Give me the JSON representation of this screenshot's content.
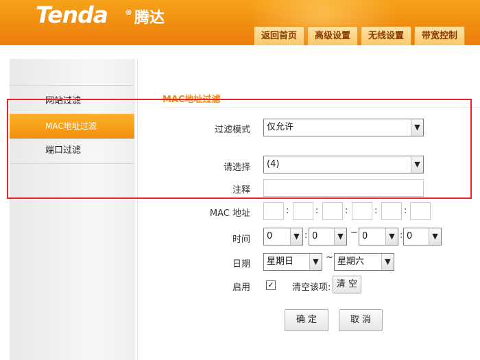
{
  "brand": {
    "logo": "Tenda",
    "registered": "®",
    "chinese": "腾达"
  },
  "nav": {
    "tabs": [
      "返回首页",
      "高级设置",
      "无线设置",
      "带宽控制"
    ]
  },
  "sidebar": {
    "items": [
      "网站过滤",
      "MAC地址过滤",
      "端口过滤"
    ]
  },
  "section": {
    "title": "MAC地址过滤"
  },
  "form": {
    "filter_mode": {
      "label": "过滤模式",
      "value": "仅允许"
    },
    "select": {
      "label": "请选择",
      "value": "(4)"
    },
    "note": {
      "label": "注释",
      "value": ""
    },
    "mac": {
      "label": "MAC 地址",
      "colon": ":"
    },
    "time": {
      "label": "时间",
      "start_hour": "0",
      "start_min": "0",
      "end_hour": "0",
      "end_min": "0",
      "colon": ":",
      "tilde": "~"
    },
    "date": {
      "label": "日期",
      "start": "星期日",
      "end": "星期六",
      "tilde": "~"
    },
    "enable": {
      "label": "启用",
      "checked_mark": "✓",
      "clear_label": "清空该项:",
      "clear_button": "清 空"
    }
  },
  "actions": {
    "confirm": "确 定",
    "cancel": "取 消"
  },
  "icons": {
    "dropdown": "chevron-down-icon",
    "check": "check-icon"
  },
  "colors": {
    "accent": "#f08a10",
    "highlight": "#e8232a"
  }
}
